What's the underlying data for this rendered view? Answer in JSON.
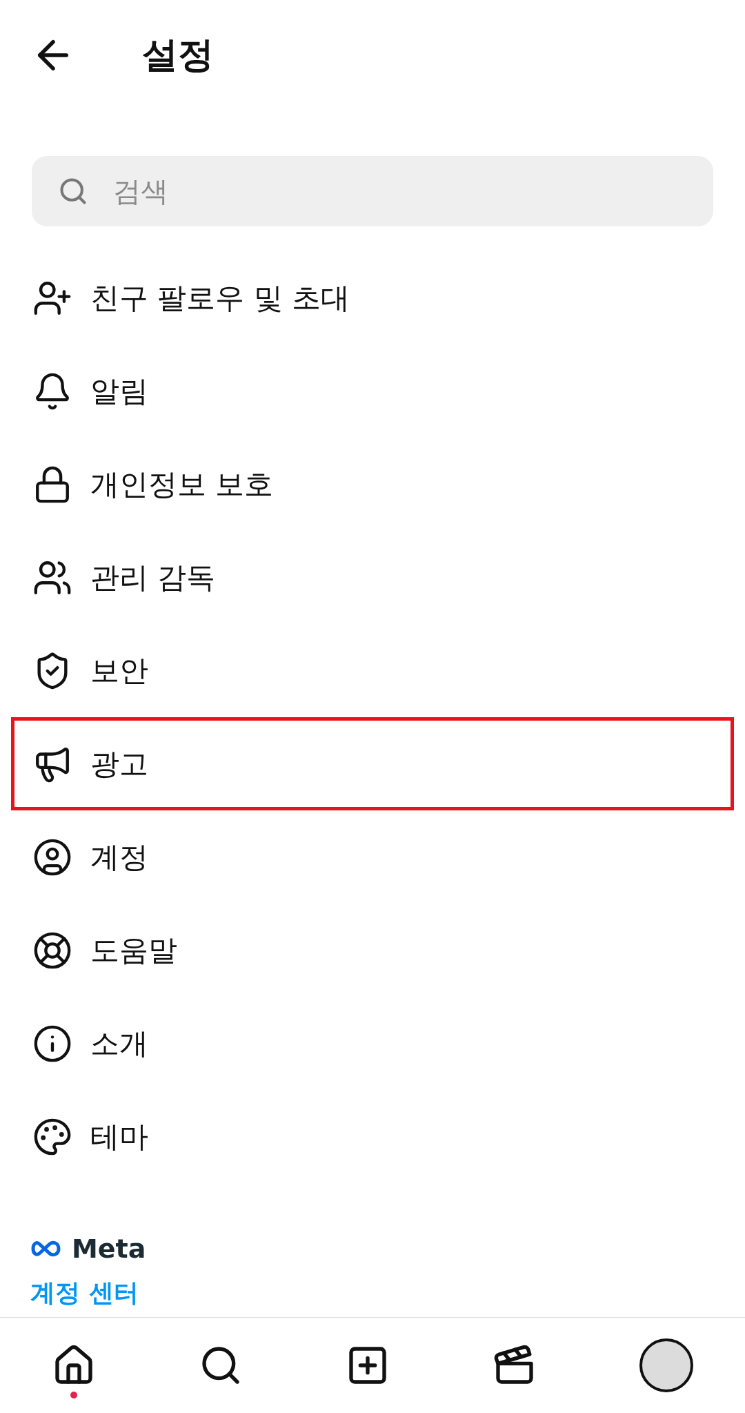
{
  "header": {
    "title": "설정"
  },
  "search": {
    "placeholder": "검색"
  },
  "items": [
    {
      "label": "친구 팔로우 및 초대",
      "highlighted": false
    },
    {
      "label": "알림",
      "highlighted": false
    },
    {
      "label": "개인정보 보호",
      "highlighted": false
    },
    {
      "label": "관리 감독",
      "highlighted": false
    },
    {
      "label": "보안",
      "highlighted": false
    },
    {
      "label": "광고",
      "highlighted": true
    },
    {
      "label": "계정",
      "highlighted": false
    },
    {
      "label": "도움말",
      "highlighted": false
    },
    {
      "label": "소개",
      "highlighted": false
    },
    {
      "label": "테마",
      "highlighted": false
    }
  ],
  "meta": {
    "brand": "Meta",
    "link": "계정 센터"
  },
  "bottom_nav": [
    {
      "kind": "home",
      "notification_dot": true
    },
    {
      "kind": "search",
      "notification_dot": false
    },
    {
      "kind": "create",
      "notification_dot": false
    },
    {
      "kind": "reels",
      "notification_dot": false
    },
    {
      "kind": "profile",
      "notification_dot": false
    }
  ]
}
